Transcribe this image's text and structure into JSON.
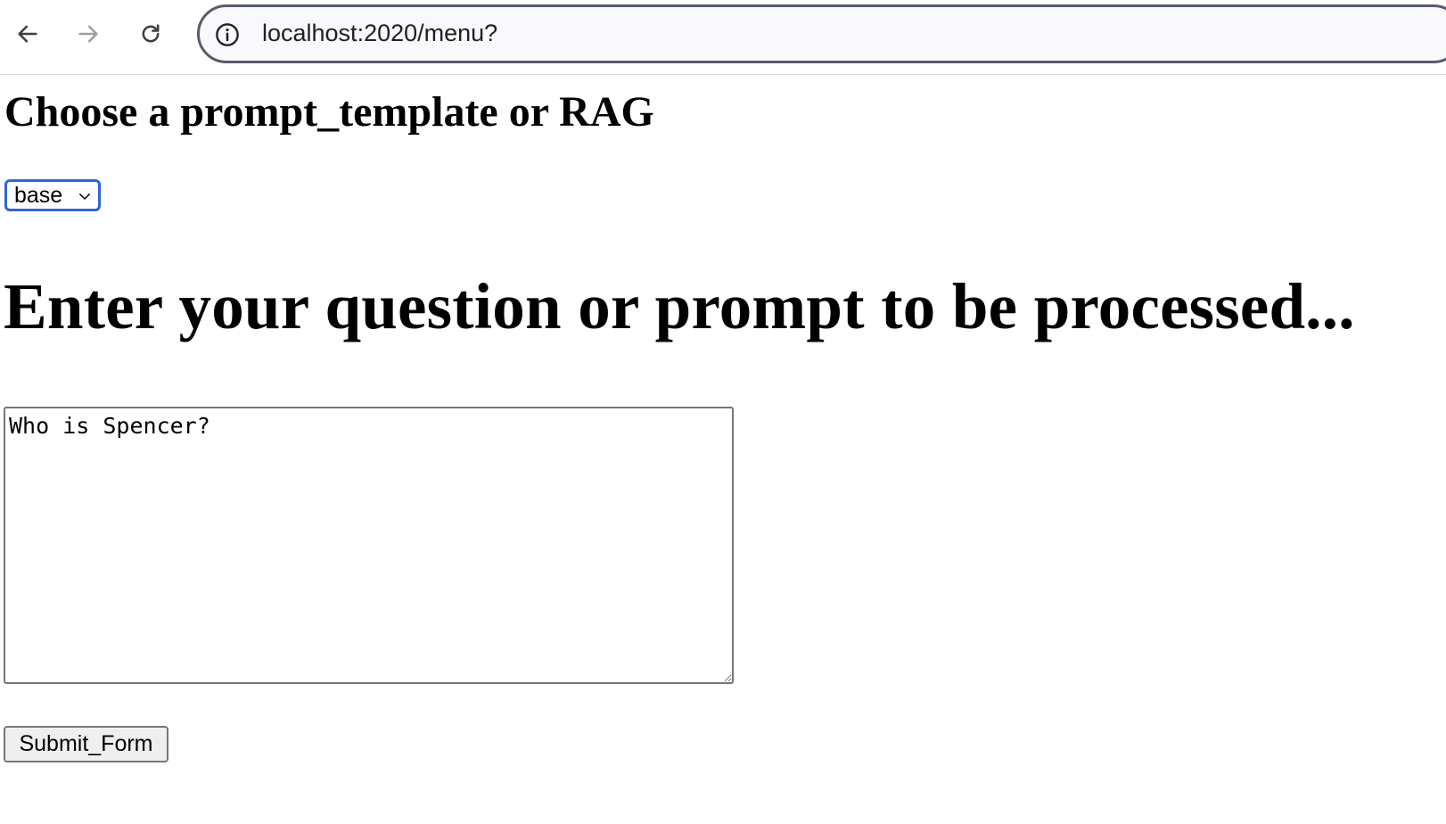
{
  "browser": {
    "url": "localhost:2020/menu?",
    "icons": {
      "back": "back-arrow-icon",
      "forward": "forward-arrow-icon",
      "reload": "reload-icon",
      "info": "info-icon"
    }
  },
  "page": {
    "choose_heading": "Choose a prompt_template or RAG",
    "template_select": {
      "selected": "base"
    },
    "prompt_heading": "Enter your question or prompt to be processed...",
    "prompt_textarea": {
      "value": "Who is Spencer?"
    },
    "submit_label": "Submit_Form"
  },
  "colors": {
    "select_focus_border": "#2f66d8",
    "address_bar_border": "#555c6b",
    "button_background": "#efefef"
  }
}
